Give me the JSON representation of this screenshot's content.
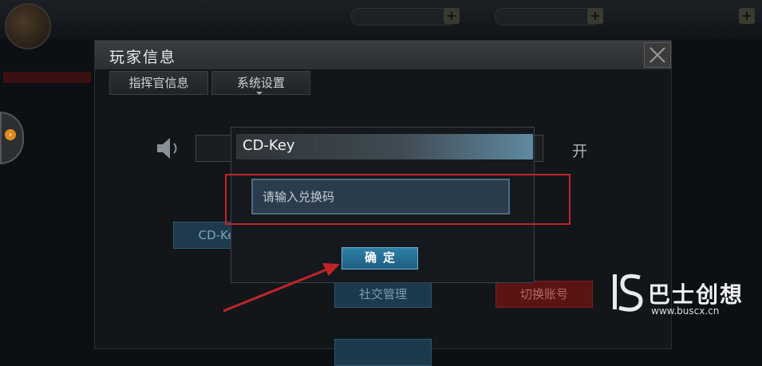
{
  "panel": {
    "title": "玩家信息",
    "tabs": [
      {
        "label": "指挥官信息"
      },
      {
        "label": "系统设置"
      }
    ],
    "sound_toggle_label": "开",
    "background_buttons": {
      "cdkey": "CD-Key",
      "social": "社交管理",
      "switch_account": "切换账号"
    }
  },
  "dialog": {
    "title": "CD-Key",
    "input_placeholder": "请输入兑换码",
    "input_value": "",
    "confirm_label": "确定"
  },
  "watermark": {
    "brand": "巴士创想",
    "url": "www.buscx.cn"
  },
  "colors": {
    "highlight": "#c0242a",
    "confirm_button": "#2e7fa6",
    "dialog_header_accent": "#5e8aa1"
  }
}
